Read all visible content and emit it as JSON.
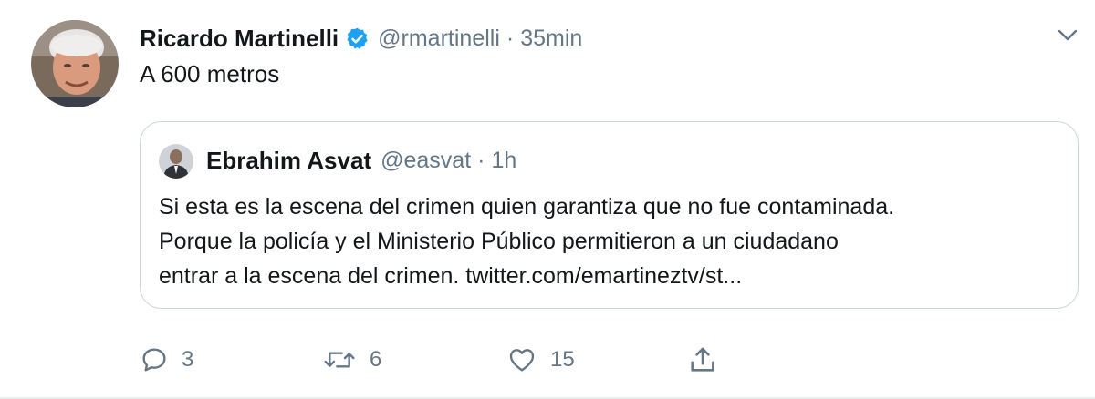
{
  "tweet": {
    "author": {
      "name": "Ricardo Martinelli",
      "handle": "@rmartinelli",
      "verified": true,
      "avatar_icon": "profile-photo"
    },
    "separator": "·",
    "time": "35min",
    "text": "A 600 metros",
    "menu_icon": "chevron-down-icon"
  },
  "quoted": {
    "author": {
      "name": "Ebrahim Asvat",
      "handle": "@easvat",
      "avatar_icon": "profile-photo"
    },
    "separator": "·",
    "time": "1h",
    "text_lines": [
      "Si esta es la escena del crimen quien garantiza que no fue contaminada.",
      "Porque la policía y el Ministerio Público permitieron a un ciudadano",
      "entrar a la escena del crimen. twitter.com/emartineztv/st..."
    ]
  },
  "actions": {
    "reply": {
      "icon": "reply-icon",
      "count": "3"
    },
    "retweet": {
      "icon": "retweet-icon",
      "count": "6"
    },
    "like": {
      "icon": "heart-icon",
      "count": "15"
    },
    "share": {
      "icon": "share-icon"
    }
  },
  "colors": {
    "text_primary": "#14171a",
    "text_secondary": "#657786",
    "verified_blue": "#1da1f2",
    "border": "#ccd6dd"
  }
}
